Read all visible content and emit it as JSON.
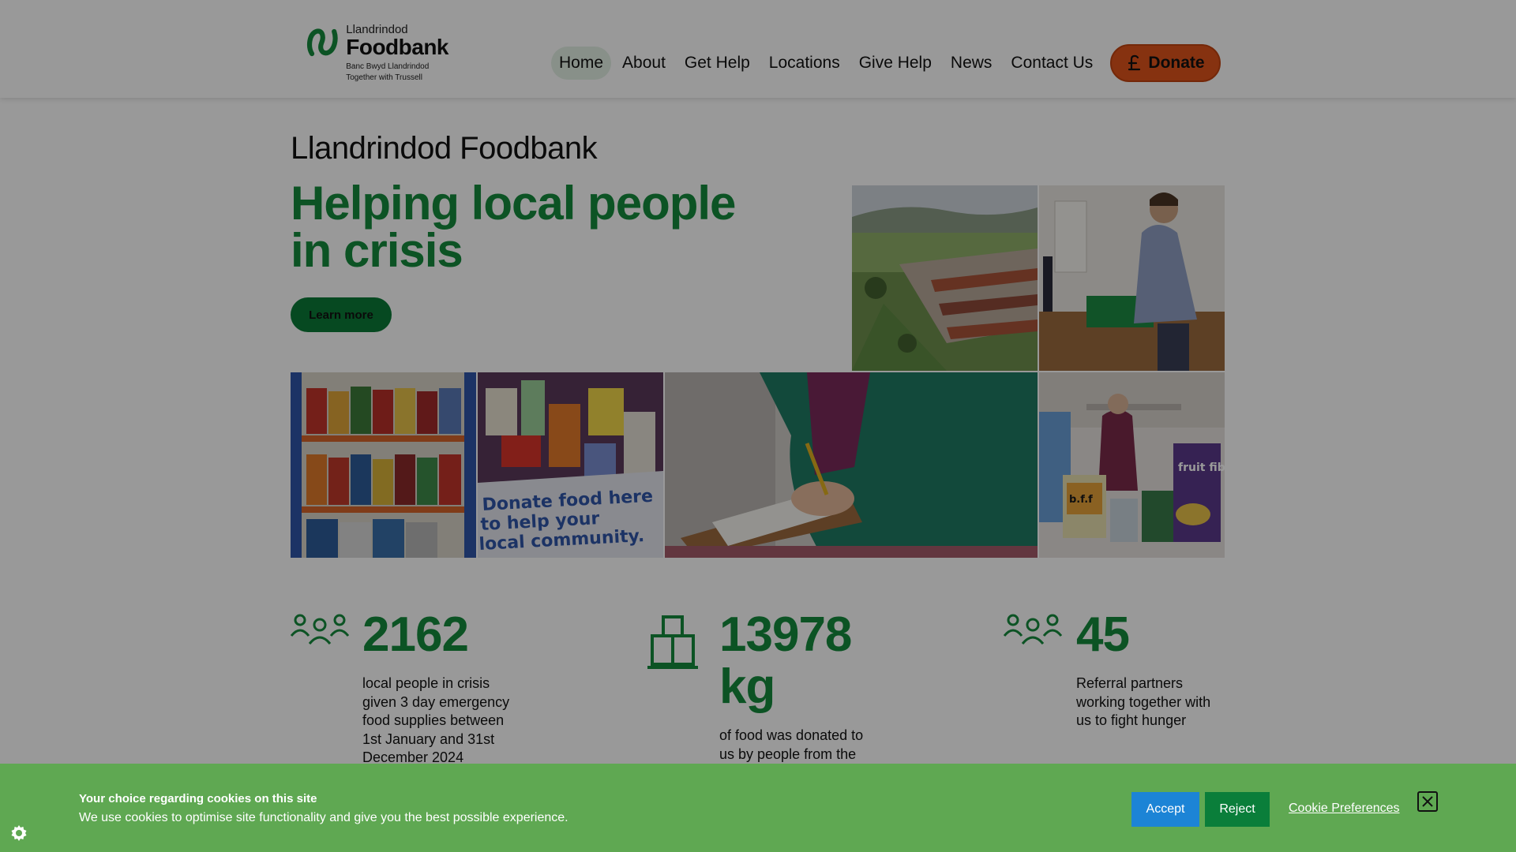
{
  "logo": {
    "line1": "Llandrindod",
    "line2": "Foodbank",
    "tag1": "Banc Bwyd Llandrindod",
    "tag2": "Together with Trussell"
  },
  "nav": {
    "items": [
      {
        "label": "Home",
        "active": true
      },
      {
        "label": "About"
      },
      {
        "label": "Get Help"
      },
      {
        "label": "Locations"
      },
      {
        "label": "Give Help"
      },
      {
        "label": "News"
      },
      {
        "label": "Contact Us"
      }
    ],
    "donate_label": "Donate"
  },
  "hero": {
    "org_name": "Llandrindod Foodbank",
    "title": "Helping local people in crisis",
    "button_label": "Learn more"
  },
  "photos": {
    "donate_box_text_line1": "Donate food here",
    "donate_box_text_line2": "to help your",
    "donate_box_text_line3": "local community.",
    "cereal_box_text": "fruit fibre",
    "bag_label": "b.f.f"
  },
  "stats": [
    {
      "icon": "people-icon",
      "number": "2162",
      "description": "local people in crisis given 3 day emergency food supplies between 1st January and 31st December 2024"
    },
    {
      "icon": "food-donation-icon",
      "number": "13978 kg",
      "description": "of food was donated to us by people from the"
    },
    {
      "icon": "people-icon",
      "number": "45",
      "description": "Referral partners working together with us to fight hunger"
    }
  ],
  "cookie": {
    "title": "Your choice regarding cookies on this site",
    "text": "We use cookies to optimise site functionality and give you the best possible experience.",
    "accept_label": "Accept",
    "reject_label": "Reject",
    "prefs_label": "Cookie Preferences"
  },
  "colors": {
    "brand_green": "#148b3c",
    "dark_green": "#0b7a37",
    "donate_orange": "#e0541c",
    "cookie_banner": "#5fa852",
    "accept_blue": "#1c84d6"
  }
}
